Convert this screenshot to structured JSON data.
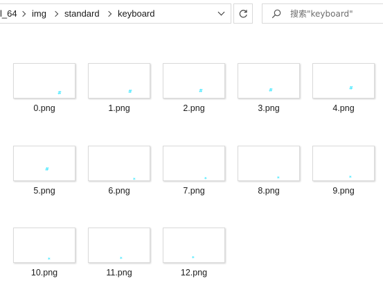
{
  "breadcrumb": {
    "items": [
      "l_64",
      "img",
      "standard",
      "keyboard"
    ]
  },
  "search": {
    "placeholder": "搜索\"keyboard\""
  },
  "files": [
    {
      "name": "0.png",
      "glyph": "#"
    },
    {
      "name": "1.png",
      "glyph": "#"
    },
    {
      "name": "2.png",
      "glyph": "#"
    },
    {
      "name": "3.png",
      "glyph": "#"
    },
    {
      "name": "4.png",
      "glyph": "#"
    },
    {
      "name": "5.png",
      "glyph": "#"
    },
    {
      "name": "6.png",
      "glyph": "*"
    },
    {
      "name": "7.png",
      "glyph": "*"
    },
    {
      "name": "8.png",
      "glyph": "*"
    },
    {
      "name": "9.png",
      "glyph": "*"
    },
    {
      "name": "10.png",
      "glyph": "*"
    },
    {
      "name": "11.png",
      "glyph": "*"
    },
    {
      "name": "12.png",
      "glyph": "*"
    }
  ],
  "icons": {
    "history_dropdown": "chevron-down-icon",
    "refresh": "refresh-icon",
    "search": "search-icon"
  },
  "colors": {
    "thumbnail_mark": "#40e8ff",
    "border": "#d9d9d9"
  }
}
